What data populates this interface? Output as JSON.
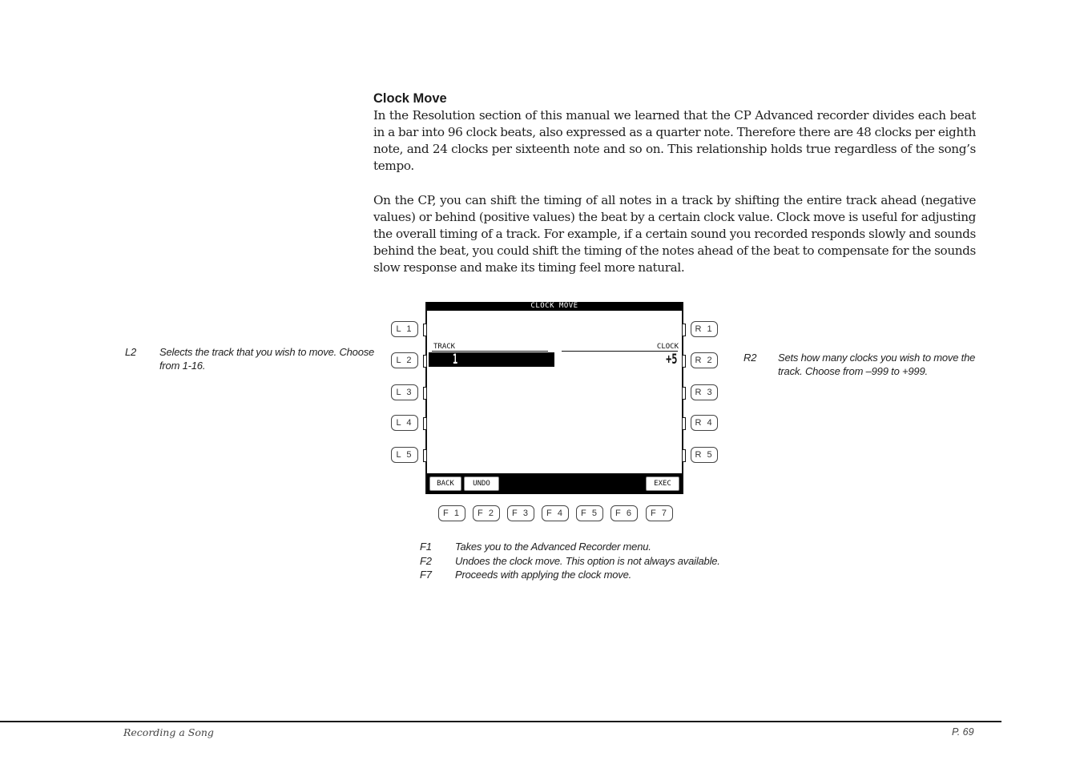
{
  "section": {
    "heading": "Clock Move",
    "paragraphs": [
      "In the Resolution section of this manual we learned that the CP Advanced recorder divides each beat in a bar into 96 clock beats, also expressed as a quarter note.  Therefore there are 48 clocks per eighth note, and 24 clocks per sixteenth note and so on.  This relationship holds true regardless of the song’s tempo.",
      "On the CP, you can shift the timing of all notes in a track by shifting the entire track ahead (negative values) or behind (positive values) the beat by a certain clock value.  Clock move is useful for adjusting the overall timing of a track.  For example, if a certain sound you recorded responds slowly and sounds behind the beat, you could shift the timing of the notes ahead of the beat to compensate for the sounds slow response and make its timing feel more natural."
    ]
  },
  "screen": {
    "title": "CLOCK MOVE",
    "track_label": "TRACK",
    "track_value": "1",
    "clock_label": "CLOCK",
    "clock_value": "+5",
    "soft_buttons": {
      "back": "BACK",
      "undo": "UNDO",
      "exec": "EXEC"
    }
  },
  "hardware_buttons": {
    "left": [
      "L 1",
      "L 2",
      "L 3",
      "L 4",
      "L 5"
    ],
    "right": [
      "R 1",
      "R 2",
      "R 3",
      "R 4",
      "R 5"
    ],
    "function": [
      "F 1",
      "F 2",
      "F 3",
      "F 4",
      "F 5",
      "F 6",
      "F 7"
    ]
  },
  "notes": {
    "l2": {
      "key": "L2",
      "text": "Selects the track that you wish to move.  Choose from 1-16."
    },
    "r2": {
      "key": "R2",
      "text": "Sets how many clocks you wish to move the track.  Choose from –999 to +999."
    },
    "function": [
      {
        "key": "F1",
        "text": "Takes you to the Advanced Recorder menu."
      },
      {
        "key": "F2",
        "text": "Undoes the clock move.  This option is not always available."
      },
      {
        "key": "F7",
        "text": "Proceeds with applying the clock move."
      }
    ]
  },
  "footer": {
    "chapter": "Recording a Song",
    "page": "P. 69"
  }
}
